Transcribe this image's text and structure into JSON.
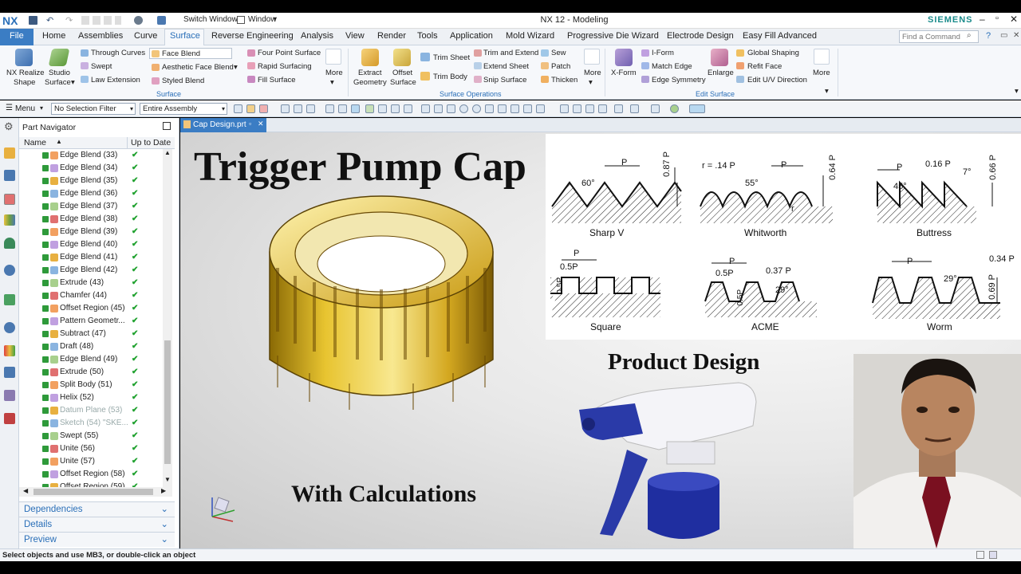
{
  "titlebar": {
    "logo": "NX",
    "switch_window": "Switch Window",
    "window": "Window",
    "title": "NX 12 - Modeling",
    "brand": "SIEMENS"
  },
  "menu_tabs": [
    "File",
    "Home",
    "Assemblies",
    "Curve",
    "Surface",
    "Reverse Engineering",
    "Analysis",
    "View",
    "Render",
    "Tools",
    "Application",
    "Mold Wizard",
    "Progressive Die Wizard",
    "Electrode Design",
    "Easy Fill Advanced"
  ],
  "find_command_placeholder": "Find a Command",
  "ribbon": {
    "realize_shape": "NX Realize",
    "realize_shape2": "Shape",
    "studio_surface": "Studio",
    "studio_surface2": "Surface",
    "through_curves": "Through Curves",
    "swept": "Swept",
    "law_extension": "Law Extension",
    "face_blend": "Face Blend",
    "aesthetic_face_blend": "Aesthetic Face Blend",
    "styled_blend": "Styled Blend",
    "four_point_surface": "Four Point Surface",
    "rapid_surfacing": "Rapid Surfacing",
    "fill_surface": "Fill Surface",
    "more1": "More",
    "group_surface": "Surface",
    "extract_geometry": "Extract",
    "extract_geometry2": "Geometry",
    "offset_surface": "Offset",
    "offset_surface2": "Surface",
    "trim_sheet": "Trim Sheet",
    "trim_body": "Trim Body",
    "trim_and_extend": "Trim and Extend",
    "extend_sheet": "Extend Sheet",
    "snip_surface": "Snip Surface",
    "sew": "Sew",
    "patch": "Patch",
    "thicken": "Thicken",
    "more2": "More",
    "group_surface_operations": "Surface Operations",
    "x_form": "X-Form",
    "i_form": "I-Form",
    "match_edge": "Match Edge",
    "edge_symmetry": "Edge Symmetry",
    "enlarge": "Enlarge",
    "global_shaping": "Global Shaping",
    "refit_face": "Refit Face",
    "edit_uv_direction": "Edit U/V Direction",
    "more3": "More",
    "group_edit_surface": "Edit Surface"
  },
  "selection": {
    "menu": "Menu",
    "filter": "No Selection Filter",
    "scope": "Entire Assembly"
  },
  "navigator": {
    "title": "Part Navigator",
    "col_name": "Name",
    "col_uptodate": "Up to Date",
    "rows": [
      "Edge Blend (33)",
      "Edge Blend (34)",
      "Edge Blend (35)",
      "Edge Blend (36)",
      "Edge Blend (37)",
      "Edge Blend (38)",
      "Edge Blend (39)",
      "Edge Blend (40)",
      "Edge Blend (41)",
      "Edge Blend (42)",
      "Extrude (43)",
      "Chamfer (44)",
      "Offset Region (45)",
      "Pattern Geometr...",
      "Subtract (47)",
      "Draft (48)",
      "Edge Blend (49)",
      "Extrude (50)",
      "Split Body (51)",
      "Helix (52)",
      "Datum Plane (53)",
      "Sketch (54) \"SKE...",
      "Swept (55)",
      "Unite (56)",
      "Unite (57)",
      "Offset Region (58)",
      "Offset Region (59)"
    ],
    "dependencies": "Dependencies",
    "details": "Details",
    "preview": "Preview"
  },
  "doc_tab": "Cap Design.prt",
  "overlay": {
    "headline": "Trigger Pump Cap",
    "product_design": "Product Design",
    "with_calculations": "With Calculations"
  },
  "threads": {
    "sharp_v": "Sharp V",
    "whitworth": "Whitworth",
    "buttress": "Buttress",
    "square": "Square",
    "acme": "ACME",
    "worm": "Worm"
  },
  "dims": {
    "p": "P",
    "a60": "60°",
    "h087": "0.87 P",
    "r014": "r = .14 P",
    "a55": "55°",
    "h064": "0.64 P",
    "r": "r",
    "a45": "45°",
    "w016": "0.16 P",
    "a7": "7°",
    "h066": "0.66 P",
    "half_p": "0.5P",
    "half_p_v": "0.5P",
    "w037": "0.37 P",
    "a29": "29°",
    "w034": "0.34 P",
    "h069": "0.69 P"
  },
  "status": "Select objects and use MB3, or double-click an object",
  "colors": {
    "accent": "#2a6fb8",
    "file_tab": "#3b7dc4",
    "cap_gold": "#e8c430",
    "check_green": "#1fa12e"
  }
}
